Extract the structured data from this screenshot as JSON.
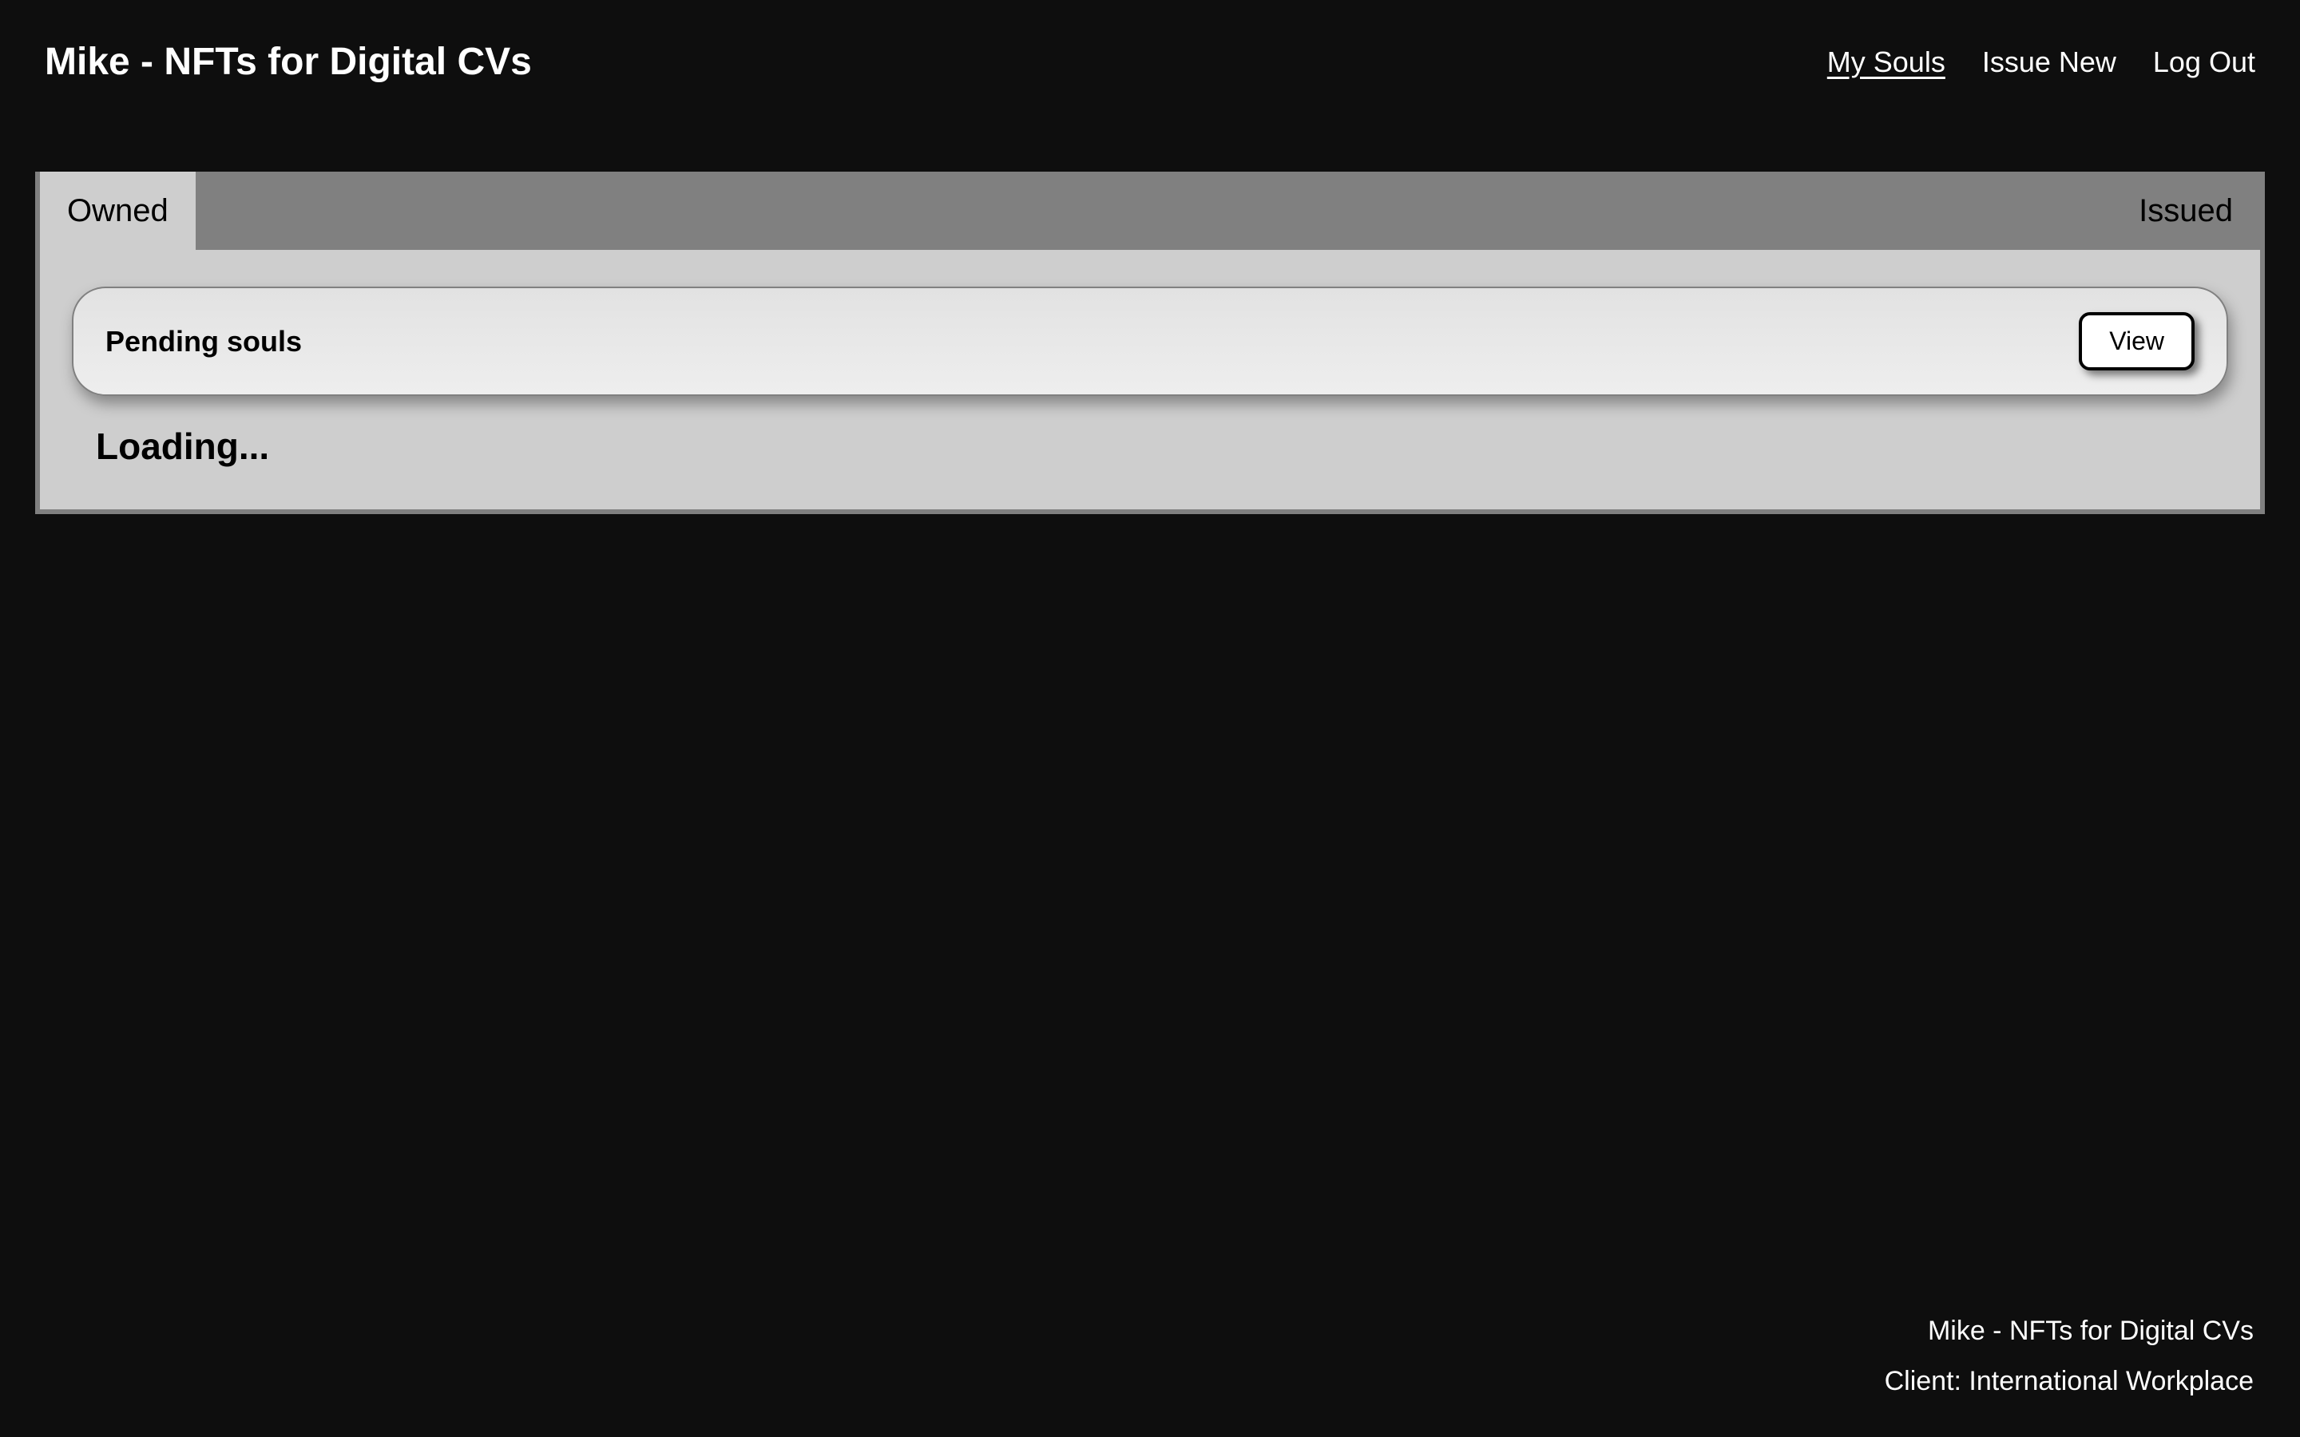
{
  "header": {
    "title": "Mike - NFTs for Digital CVs",
    "nav": {
      "my_souls": "My Souls",
      "issue_new": "Issue New",
      "log_out": "Log Out"
    }
  },
  "tabs": {
    "owned": "Owned",
    "issued": "Issued"
  },
  "panel": {
    "card_title": "Pending souls",
    "view_button": "View",
    "loading": "Loading..."
  },
  "footer": {
    "line1": "Mike - NFTs for Digital CVs",
    "line2": "Client: International Workplace"
  }
}
